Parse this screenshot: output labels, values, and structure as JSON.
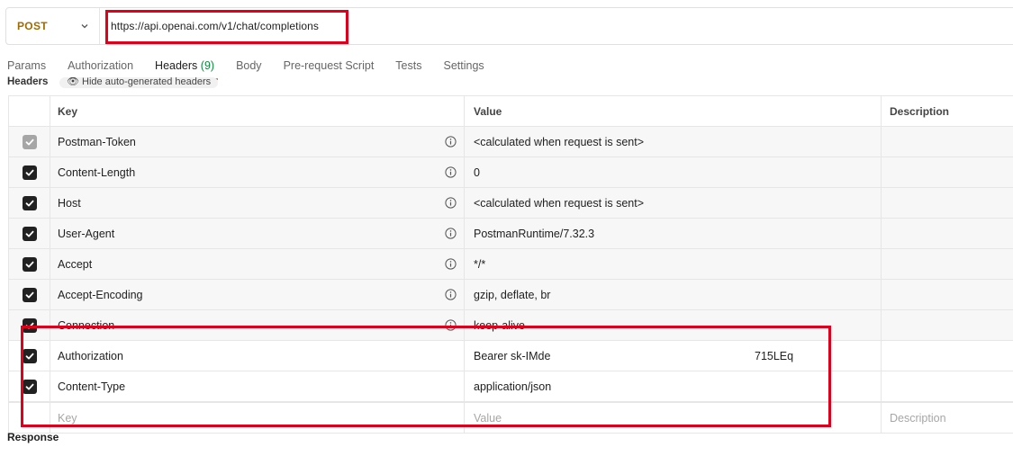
{
  "request": {
    "method": "POST",
    "url": "https://api.openai.com/v1/chat/completions"
  },
  "tabs": [
    {
      "label": "Params"
    },
    {
      "label": "Authorization"
    },
    {
      "label": "Headers",
      "count": "(9)"
    },
    {
      "label": "Body"
    },
    {
      "label": "Pre-request Script"
    },
    {
      "label": "Tests"
    },
    {
      "label": "Settings"
    }
  ],
  "peek": {
    "title": "Headers",
    "button": "Hide auto-generated headers"
  },
  "table": {
    "columns": {
      "key": "Key",
      "value": "Value",
      "description": "Description"
    },
    "rows": [
      {
        "key": "Postman-Token",
        "value": "<calculated when request is sent>",
        "checked": true,
        "disabled": true
      },
      {
        "key": "Content-Length",
        "value": "0",
        "checked": true
      },
      {
        "key": "Host",
        "value": "<calculated when request is sent>",
        "checked": true
      },
      {
        "key": "User-Agent",
        "value": "PostmanRuntime/7.32.3",
        "checked": true
      },
      {
        "key": "Accept",
        "value": "*/*",
        "checked": true
      },
      {
        "key": "Accept-Encoding",
        "value": "gzip, deflate, br",
        "checked": true
      },
      {
        "key": "Connection",
        "value": "keep-alive",
        "checked": true
      },
      {
        "key": "Authorization",
        "value": "Bearer sk-IMde",
        "value_suffix": "715LEq",
        "checked": true
      },
      {
        "key": "Content-Type",
        "value": "application/json",
        "checked": true
      }
    ],
    "new_row": {
      "key_placeholder": "Key",
      "value_placeholder": "Value",
      "description_placeholder": "Description"
    }
  },
  "response": {
    "label": "Response"
  },
  "colors": {
    "accent": "#ff6c37",
    "method": "#a06b00",
    "highlight": "#e0001b",
    "count": "#0b8a3c"
  }
}
